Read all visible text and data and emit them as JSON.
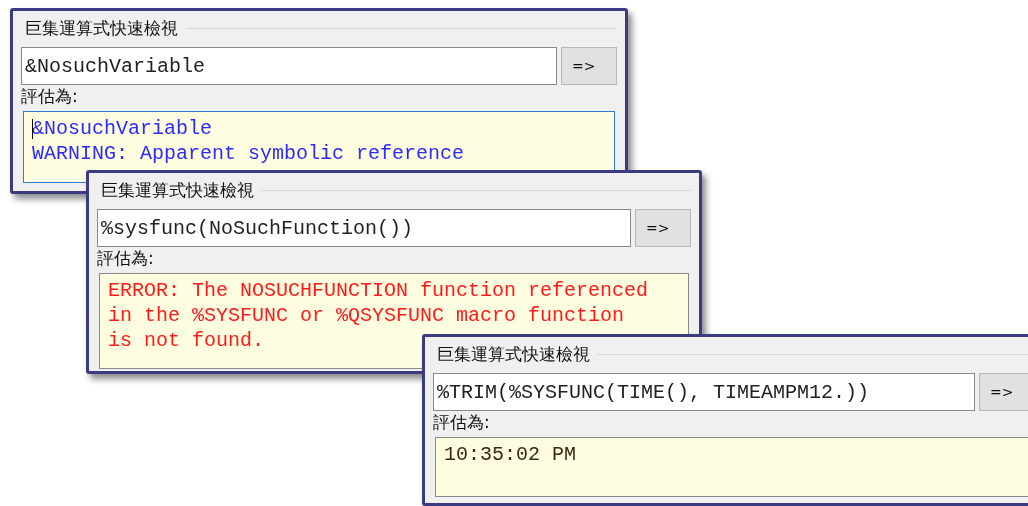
{
  "windows": [
    {
      "title": "巨集運算式快速檢視",
      "expression": "&NosuchVariable",
      "button": "=>",
      "result_label": "評估為:",
      "result": {
        "kind": "warning",
        "focused": true,
        "lines": [
          "&NosuchVariable",
          "WARNING: Apparent symbolic reference"
        ]
      }
    },
    {
      "title": "巨集運算式快速檢視",
      "expression": "%sysfunc(NoSuchFunction())",
      "button": "=>",
      "result_label": "評估為:",
      "result": {
        "kind": "error",
        "focused": false,
        "lines": [
          "ERROR: The NOSUCHFUNCTION function referenced",
          "in the %SYSFUNC or %QSYSFUNC macro function",
          "is not found."
        ]
      }
    },
    {
      "title": "巨集運算式快速檢視",
      "expression": "%TRIM(%SYSFUNC(TIME(), TIMEAMPM12.))",
      "button": "=>",
      "result_label": "評估為:",
      "result": {
        "kind": "normal",
        "focused": false,
        "lines": [
          "10:35:02 PM"
        ]
      }
    }
  ]
}
